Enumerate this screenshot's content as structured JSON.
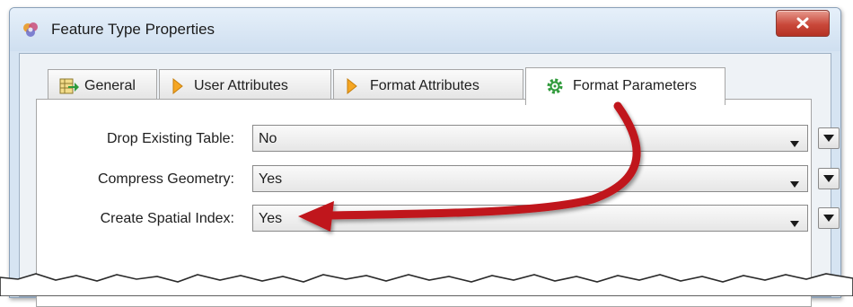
{
  "window": {
    "title": "Feature Type Properties",
    "icon": "fme-app-icon",
    "close_icon": "close-icon"
  },
  "tabs": [
    {
      "label": "General",
      "icon": "table-arrow-icon",
      "active": false
    },
    {
      "label": "User Attributes",
      "icon": "orange-diamond-icon",
      "active": false
    },
    {
      "label": "Format Attributes",
      "icon": "orange-diamond-icon",
      "active": false
    },
    {
      "label": "Format Parameters",
      "icon": "green-gear-icon",
      "active": true
    }
  ],
  "parameters": [
    {
      "label": "Drop Existing Table:",
      "value": "No"
    },
    {
      "label": "Compress Geometry:",
      "value": "Yes"
    },
    {
      "label": "Create Spatial Index:",
      "value": "Yes"
    }
  ],
  "annotation": {
    "type": "red-arrow",
    "color": "#c0141a"
  },
  "colors": {
    "accent_arrow": "#c0141a",
    "close_button": "#c9483a",
    "titlebar": "#d6e4f2"
  }
}
